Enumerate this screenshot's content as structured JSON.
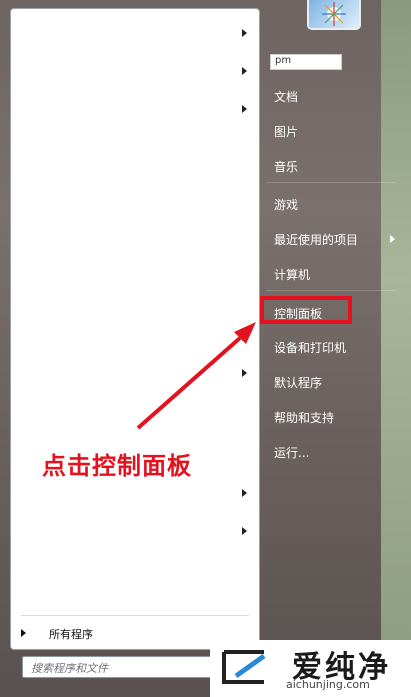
{
  "start_menu": {
    "left_pane": {
      "all_programs_label": "所有程序",
      "search_placeholder": "搜索程序和文件"
    },
    "right_pane": {
      "username": "pm",
      "items": [
        {
          "label": "文档"
        },
        {
          "label": "图片"
        },
        {
          "label": "音乐"
        },
        {
          "label": "游戏"
        },
        {
          "label": "最近使用的项目",
          "has_submenu": true
        },
        {
          "label": "计算机"
        },
        {
          "label": "控制面板",
          "highlighted": true
        },
        {
          "label": "设备和打印机"
        },
        {
          "label": "默认程序"
        },
        {
          "label": "帮助和支持"
        },
        {
          "label": "运行..."
        }
      ]
    }
  },
  "annotation": {
    "text": "点击控制面板",
    "color": "#e3121e"
  },
  "watermark": {
    "brand": "爱纯净",
    "url": "aichunjing.com"
  },
  "icons": {
    "avatar": "user-avatar-icon",
    "search": "search-icon",
    "logo": "aichunjing-logo-icon"
  }
}
